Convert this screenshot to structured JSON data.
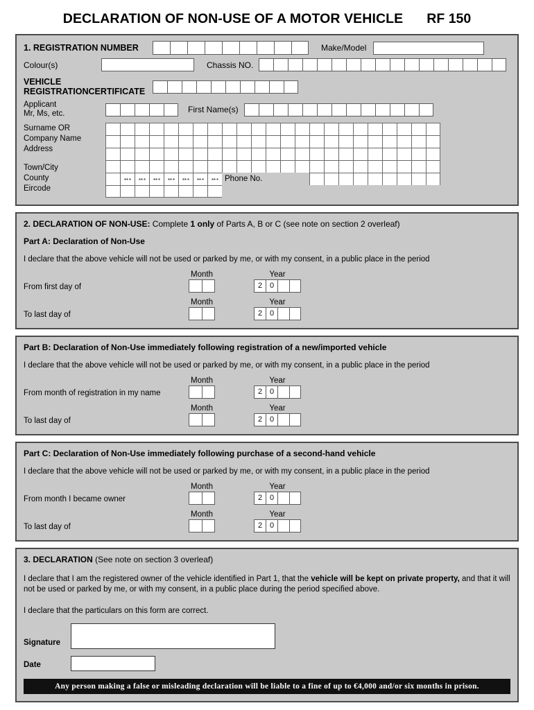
{
  "header": {
    "title": "DECLARATION OF NON-USE OF A MOTOR VEHICLE",
    "form_code": "RF 150"
  },
  "section1": {
    "heading": "1. REGISTRATION NUMBER",
    "registration_boxes": 9,
    "make_model_label": "Make/Model",
    "make_model_value": "",
    "colour_label": "Colour(s)",
    "colour_value": "",
    "chassis_label": "Chassis NO.",
    "chassis_boxes": 17,
    "vrc_label": "VEHICLE REGISTRATIONCERTIFICATE",
    "vrc_boxes": 10,
    "applicant_label_line1": "Applicant",
    "applicant_label_line2": "Mr, Ms, etc.",
    "applicant_boxes": 5,
    "first_names_label": "First Name(s)",
    "first_names_boxes": 13,
    "address_labels": [
      "Surname OR",
      "Company Name",
      "Address",
      "Town/City",
      "County",
      "Eircode"
    ],
    "phone_label": "Phone No.",
    "address_columns": 23,
    "address_rows": 6
  },
  "section2": {
    "heading_bold": "2.  DECLARATION OF NON-USE:",
    "heading_rest_a": " Complete ",
    "heading_bold2": "1 only",
    "heading_rest_b": " of Parts A, B or C (see note on section 2   overleaf)",
    "parts": [
      {
        "id": "part-a",
        "title": "Part A: Declaration of Non-Use",
        "declaration": "I declare that the above vehicle will not be used or parked by me, or with my consent, in a public place in the period",
        "rows": [
          {
            "label": "From first day of",
            "month_caption": "Month",
            "year_caption": "Year",
            "month_boxes": 2,
            "year_prefill": [
              "2",
              "0"
            ],
            "year_blank": 2
          },
          {
            "label": "To last day of",
            "month_caption": "Month",
            "year_caption": "Year",
            "month_boxes": 2,
            "year_prefill": [
              "2",
              "0"
            ],
            "year_blank": 2
          }
        ]
      },
      {
        "id": "part-b",
        "title": "Part B: Declaration of Non-Use immediately following registration of a new/imported vehicle",
        "declaration": "I declare that the above vehicle will not be used or parked by me, or with my consent, in a public place in the period",
        "rows": [
          {
            "label": "From month of registration in my name",
            "month_caption": "Month",
            "year_caption": "Year",
            "month_boxes": 2,
            "year_prefill": [
              "2",
              "0"
            ],
            "year_blank": 2
          },
          {
            "label": "To last day of",
            "month_caption": "Month",
            "year_caption": "Year",
            "month_boxes": 2,
            "year_prefill": [
              "2",
              "0"
            ],
            "year_blank": 2
          }
        ]
      },
      {
        "id": "part-c",
        "title": "Part C: Declaration of Non-Use immediately following purchase of a second-hand vehicle",
        "declaration": "I declare that the above vehicle will not be used or parked by me, or with my consent, in a public place in the period",
        "rows": [
          {
            "label": "From month I became  owner",
            "month_caption": "Month",
            "year_caption": "Year",
            "month_boxes": 2,
            "year_prefill": [
              "2",
              "0"
            ],
            "year_blank": 2
          },
          {
            "label": "To last day of",
            "month_caption": "Month",
            "year_caption": "Year",
            "month_boxes": 2,
            "year_prefill": [
              "2",
              "0"
            ],
            "year_blank": 2
          }
        ]
      }
    ]
  },
  "section3": {
    "heading_bold": "3. DECLARATION",
    "heading_rest": " (See note on section 3 overleaf)",
    "para1_a": "I declare that I am the registered owner of the vehicle identified in Part 1, that the ",
    "para1_bold": "vehicle will be kept on private  property,",
    "para1_b": " and that it will not be used or parked by me, or with my consent, in a public place during the period specified above.",
    "para2": "I declare that the particulars on this form are correct.",
    "signature_label": "Signature",
    "signature_value": "",
    "date_label": "Date",
    "date_value": "",
    "warning": "Any person making a false or misleading declaration will be liable to a fine of up to €4,000 and/or six months in prison."
  }
}
